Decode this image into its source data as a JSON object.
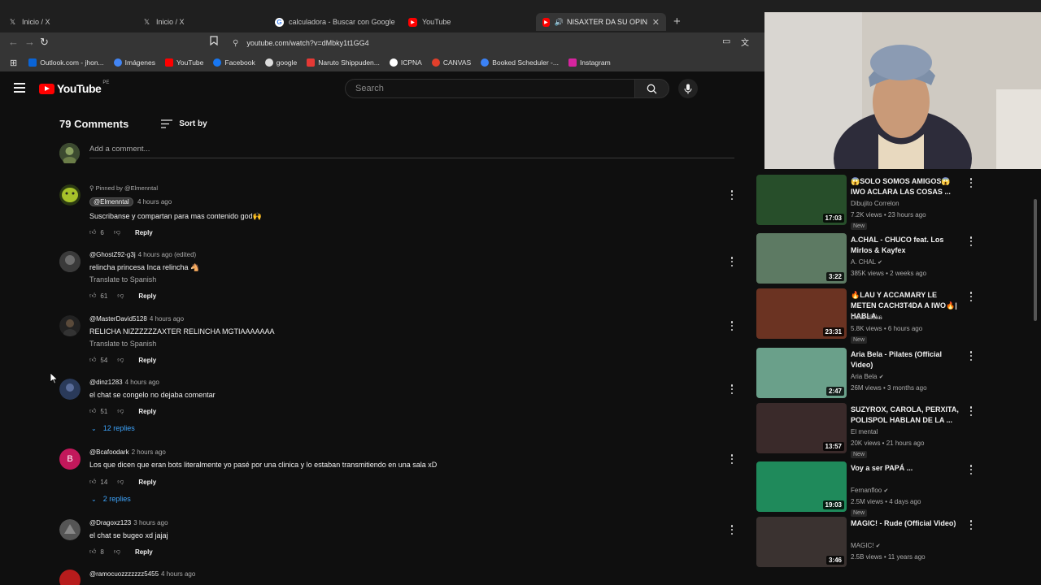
{
  "browser": {
    "tabs": [
      {
        "label": "Inicio / X",
        "icon": "x-icon"
      },
      {
        "label": "Inicio / X",
        "icon": "x-icon"
      },
      {
        "label": "calculadora - Buscar con Google",
        "icon": "google-icon"
      },
      {
        "label": "YouTube",
        "icon": "youtube-icon"
      },
      {
        "label": "NISAXTER DA SU OPINIÓN S",
        "icon": "youtube-icon",
        "active": true
      }
    ],
    "url": "youtube.com/watch?v=dMbky1t1GG4",
    "bookmarks": [
      {
        "label": "Outlook.com - jhon...",
        "color": "#0a64d6"
      },
      {
        "label": "Imágenes",
        "color": "#4285f4"
      },
      {
        "label": "YouTube",
        "color": "#ff0000"
      },
      {
        "label": "Facebook",
        "color": "#1877f2"
      },
      {
        "label": "google",
        "color": "#dddddd"
      },
      {
        "label": "Naruto Shippuden...",
        "color": "#e53935"
      },
      {
        "label": "ICPNA",
        "color": "#ffffff"
      },
      {
        "label": "CANVAS",
        "color": "#e13f2b"
      },
      {
        "label": "Booked Scheduler -...",
        "color": "#3b82f6"
      },
      {
        "label": "Instagram",
        "color": "#d6249f"
      }
    ]
  },
  "youtube": {
    "logo": "YouTube",
    "country": "PE",
    "search_placeholder": "Search"
  },
  "comments": {
    "count_label": "79 Comments",
    "sort_label": "Sort by",
    "add_placeholder": "Add a comment...",
    "reply_label": "Reply",
    "translate_label": "Translate to Spanish",
    "items": [
      {
        "pinned": "Pinned by @Elmenntal",
        "author": "@Elmenntal",
        "time": "4 hours ago",
        "text": "Suscribanse y compartan para mas contenido god🙌",
        "likes": "6"
      },
      {
        "author": "@GhostZ92-g3j",
        "time": "4 hours ago (edited)",
        "text": "relincha princesa Inca relincha 🐴",
        "likes": "61"
      },
      {
        "author": "@MasterDavid5128",
        "time": "4 hours ago",
        "text": "RELICHA NIZZZZZZAXTER RELINCHA MGTIAAAAAAA",
        "likes": "54"
      },
      {
        "author": "@dinz1283",
        "time": "4 hours ago",
        "text": "el chat se congelo no dejaba comentar",
        "likes": "51",
        "replies": "12 replies"
      },
      {
        "author": "@Bcafoodark",
        "time": "2 hours ago",
        "text": "Los que dicen que eran bots literalmente yo pasé por una clinica y lo estaban transmitiendo en una sala xD",
        "likes": "14",
        "replies": "2 replies",
        "avatar_letter": "B"
      },
      {
        "author": "@Dragoxz123",
        "time": "3 hours ago",
        "text": "el chat se bugeo xd jajaj",
        "likes": "8"
      },
      {
        "author": "@ramocuozzzzzzz5455",
        "time": "4 hours ago"
      }
    ]
  },
  "recommended": [
    {
      "title": "😱SOLO SOMOS AMIGOS😱 IWO ACLARA LAS COSAS ...",
      "channel": "Dibujito Correlon",
      "views": "7.2K views • 23 hours ago",
      "duration": "17:03",
      "new": "New",
      "color": "#274e2a"
    },
    {
      "title": "A.CHAL - CHUCO  feat. Los Mirlos & Kayfex",
      "channel": "A. CHAL",
      "views": "385K views • 2 weeks ago",
      "duration": "3:22",
      "verified": true,
      "color": "#5d7a63"
    },
    {
      "title": "🔥LAU Y ACCAMARY LE METEN CACH3T4DA A IWO🔥| HABLA...",
      "channel": "Dota clicks",
      "views": "5.8K views • 6 hours ago",
      "duration": "23:31",
      "new": "New",
      "color": "#6b3322"
    },
    {
      "title": "Aria Bela - Pilates (Official Video)",
      "channel": "Aria Bela",
      "views": "26M views • 3 months ago",
      "duration": "2:47",
      "verified": true,
      "color": "#6aa08a"
    },
    {
      "title": "SUZYROX, CAROLA, PERXITA, POLISPOL HABLAN DE LA ...",
      "channel": "El mental",
      "views": "20K views • 21 hours ago",
      "duration": "13:57",
      "new": "New",
      "color": "#3a2a2a"
    },
    {
      "title": "Voy a ser PAPÁ ...",
      "channel": "Fernanfloo",
      "views": "2.5M views • 4 days ago",
      "duration": "19:03",
      "new": "New",
      "verified": true,
      "color": "#1f8a5b"
    },
    {
      "title": "MAGIC! - Rude (Official Video)",
      "channel": "MAGIC!",
      "views": "2.5B views • 11 years ago",
      "duration": "3:46",
      "verified": true,
      "color": "#3a3230"
    }
  ]
}
